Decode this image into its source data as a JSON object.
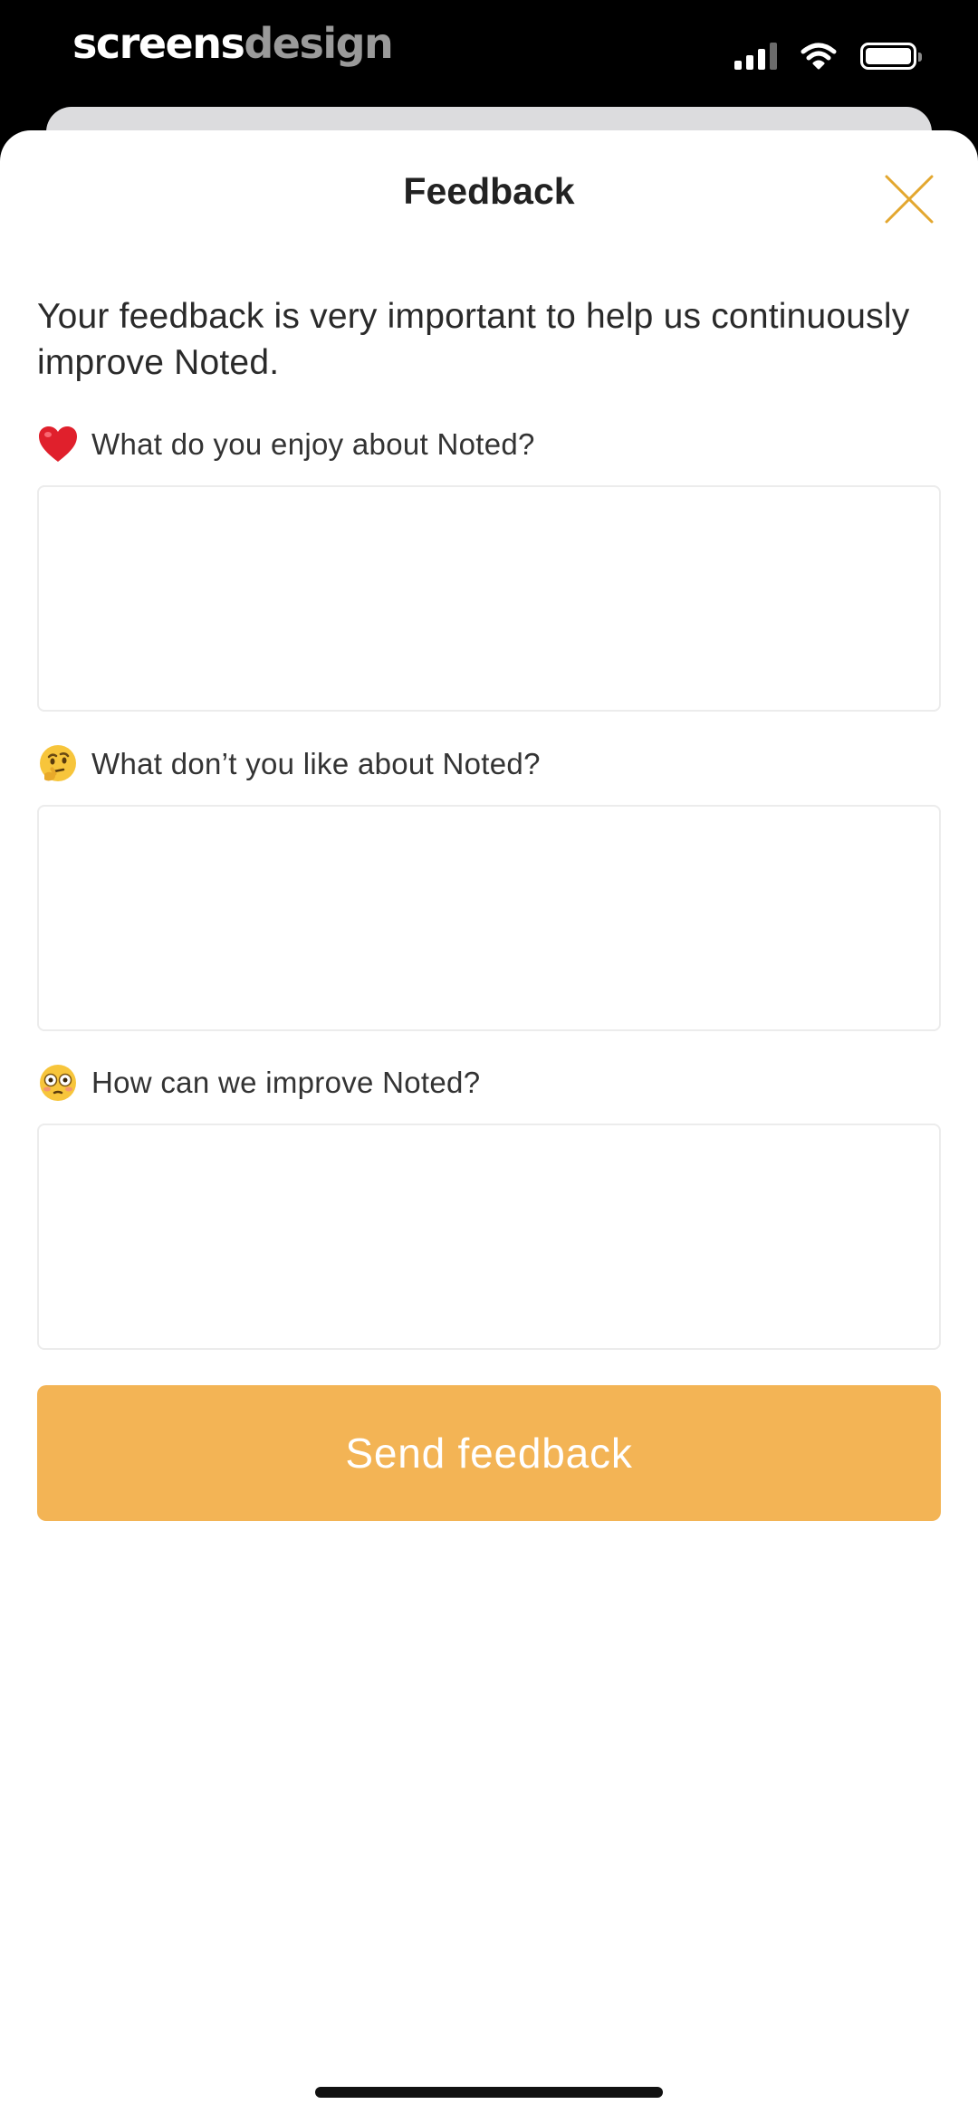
{
  "watermark": {
    "part1": "screens",
    "part2": "design"
  },
  "status_bar": {
    "icons": [
      "cellular-signal-icon",
      "wifi-icon",
      "battery-icon"
    ]
  },
  "sheet": {
    "title": "Feedback",
    "close_icon": "close-icon",
    "intro": "Your feedback is very important to help us continuously improve Noted."
  },
  "questions": [
    {
      "icon": "heart-emoji-icon",
      "label": "What do you enjoy about Noted?",
      "value": "",
      "placeholder": ""
    },
    {
      "icon": "thinking-face-emoji-icon",
      "label": "What don’t you like about Noted?",
      "value": "",
      "placeholder": ""
    },
    {
      "icon": "flushed-face-emoji-icon",
      "label": "How can we improve Noted?",
      "value": "",
      "placeholder": ""
    }
  ],
  "submit": {
    "label": "Send feedback"
  },
  "colors": {
    "accent": "#f3b455",
    "close_icon": "#e3a72f",
    "sheet_background": "#ffffff",
    "field_border": "#ececec",
    "status_bar_background": "#000000"
  }
}
